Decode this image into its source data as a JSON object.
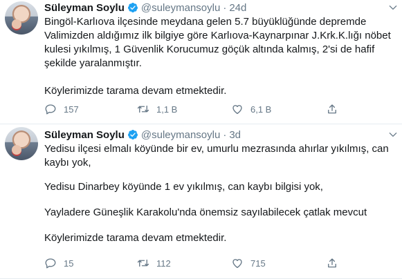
{
  "tweets": [
    {
      "name": "Süleyman Soylu",
      "handle": "@suleymansoylu",
      "separator": "·",
      "time": "24d",
      "paragraphs": [
        "Bingöl-Karlıova ilçesinde meydana gelen 5.7 büyüklüğünde depremde\nValimizden aldığımız ilk bilgiye göre Karlıova-Kaynarpınar J.Krk.K.lığı nöbet\nkulesi yıkılmış, 1 Güvenlik Korucumuz göçük altında kalmış, 2'si de hafif\nşekilde yaralanmıştır.",
        "Köylerimizde tarama devam etmektedir."
      ],
      "replies": "157",
      "retweets": "1,1 B",
      "likes": "6,1 B"
    },
    {
      "name": "Süleyman Soylu",
      "handle": "@suleymansoylu",
      "separator": "·",
      "time": "3d",
      "paragraphs": [
        "Yedisu ilçesi elmalı köyünde bir ev, umurlu mezrasında ahırlar yıkılmış, can\nkaybı yok,",
        "Yedisu Dinarbey köyünde 1 ev yıkılmış, can kaybı bilgisi yok,",
        "Yayladere Güneşlik Karakolu'nda önemsiz sayılabilecek çatlak mevcut",
        "Köylerimizde tarama devam etmektedir."
      ],
      "replies": "15",
      "retweets": "112",
      "likes": "715"
    }
  ],
  "icons": {
    "verified": "verified-badge-icon",
    "reply": "reply-icon",
    "retweet": "retweet-icon",
    "like": "heart-icon",
    "share": "share-icon",
    "menu": "chevron-down-icon"
  },
  "colors": {
    "text": "#14171a",
    "muted": "#657786",
    "verified": "#1da1f2"
  }
}
